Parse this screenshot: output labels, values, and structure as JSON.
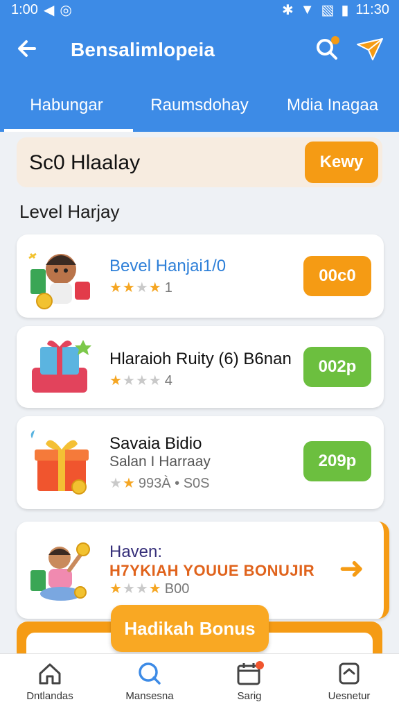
{
  "status_bar": {
    "time_left": "1:00",
    "time_right": "11:30"
  },
  "app_bar": {
    "title": "Bensalimlopeia"
  },
  "tabs": [
    {
      "label": "Habungar",
      "active": true
    },
    {
      "label": "Raumsdohay",
      "active": false
    },
    {
      "label": "Mdia Inagaa",
      "active": false
    }
  ],
  "promo": {
    "text": "Sc0 Hlaalay",
    "button": "Kewy"
  },
  "section_title": "Level Harjay",
  "cards": [
    {
      "title": "Bevel Hanjai1/0",
      "rating": 3,
      "rating_text": "1",
      "action": "00c0",
      "action_color": "#f59b14"
    },
    {
      "title": "Hlaraioh Ruity (6) B6nan",
      "rating": 1,
      "rating_text": "4",
      "action": "002p",
      "action_color": "#6cbf3f"
    },
    {
      "title": "Savaia Bidio",
      "subtitle": "Salan I Harraay",
      "rating_text": "993À • S0S",
      "action": "209p",
      "action_color": "#6cbf3f"
    }
  ],
  "bonus_card": {
    "label1": "Haven:",
    "label2": "H7YKIAH YOUUE BONUJIR",
    "rating_text": "B00"
  },
  "floating_button": "Hadikah Bonus",
  "bottom_nav": [
    {
      "label": "Dntlandas",
      "icon": "home-icon"
    },
    {
      "label": "Mansesna",
      "icon": "search-icon"
    },
    {
      "label": "Sarig",
      "icon": "calendar-icon"
    },
    {
      "label": "Uesnetur",
      "icon": "profile-icon"
    }
  ],
  "colors": {
    "primary": "#3d8be6",
    "accent": "#f59b14",
    "green": "#6cbf3f"
  }
}
